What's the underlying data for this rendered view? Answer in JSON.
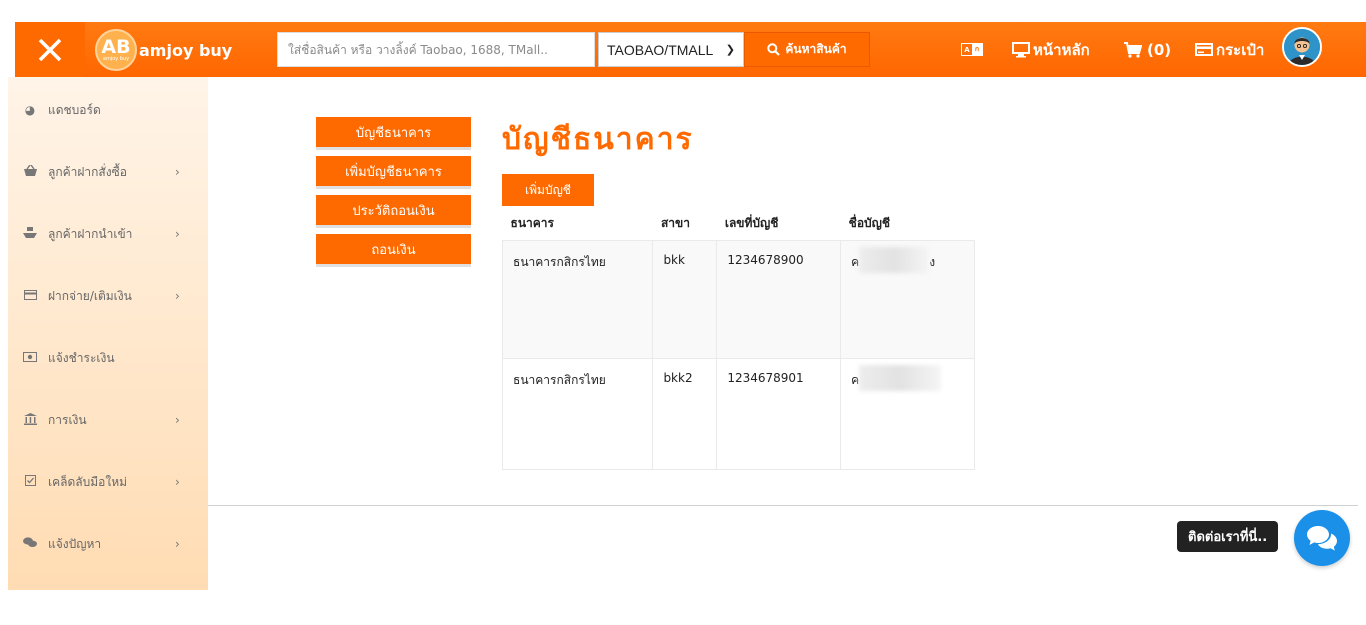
{
  "header": {
    "logo_badge": "AB",
    "logo_badge_small": "amjoy buy",
    "logo_text": "amjoy buy",
    "search_placeholder": "ใส่ชื่อสินค้า หรือ วางลิ้งค์ Taobao, 1688, TMall..",
    "search_source": "TAOBAO/TMALL",
    "search_button": "ค้นหาสินค้า",
    "lang_left": "A",
    "lang_right": "ก",
    "home_label": "หน้าหลัก",
    "cart_label": "(0)",
    "wallet_label": "กระเป๋า",
    "accent_color": "#ff6a00"
  },
  "sidebar": {
    "items": [
      {
        "icon": "pie-chart-icon",
        "label": "แดชบอร์ด",
        "has_arrow": false
      },
      {
        "icon": "basket-icon",
        "label": "ลูกค้าฝากสั่งซื้อ",
        "has_arrow": true
      },
      {
        "icon": "ship-icon",
        "label": "ลูกค้าฝากนำเข้า",
        "has_arrow": true
      },
      {
        "icon": "credit-card-icon",
        "label": "ฝากจ่าย/เติมเงิน",
        "has_arrow": true
      },
      {
        "icon": "money-icon",
        "label": "แจ้งชำระเงิน",
        "has_arrow": false
      },
      {
        "icon": "bank-icon",
        "label": "การเงิน",
        "has_arrow": true
      },
      {
        "icon": "checkbox-icon",
        "label": "เคล็ดลับมือใหม่",
        "has_arrow": true
      },
      {
        "icon": "comments-icon",
        "label": "แจ้งปัญหา",
        "has_arrow": true
      }
    ]
  },
  "account_menu": {
    "items": [
      "บัญชีธนาคาร",
      "เพิ่มบัญชีธนาคาร",
      "ประวัติถอนเงิน",
      "ถอนเงิน"
    ]
  },
  "main": {
    "title": "บัญชีธนาคาร",
    "add_button": "เพิ่มบัญชี",
    "columns": [
      "ธนาคาร",
      "สาขา",
      "เลขที่บัญชี",
      "ชื่อบัญชี"
    ],
    "rows": [
      {
        "bank": "ธนาคารกสิกรไทย",
        "branch": "bkk",
        "account_no": "1234678900",
        "name_prefix": "ค",
        "name_suffix": "ง"
      },
      {
        "bank": "ธนาคารกสิกรไทย",
        "branch": "bkk2",
        "account_no": "1234678901",
        "name_prefix": "ค",
        "name_suffix": ""
      }
    ]
  },
  "contact": {
    "label": "ติดต่อเราที่นี่..",
    "icon": "chat-icon"
  }
}
